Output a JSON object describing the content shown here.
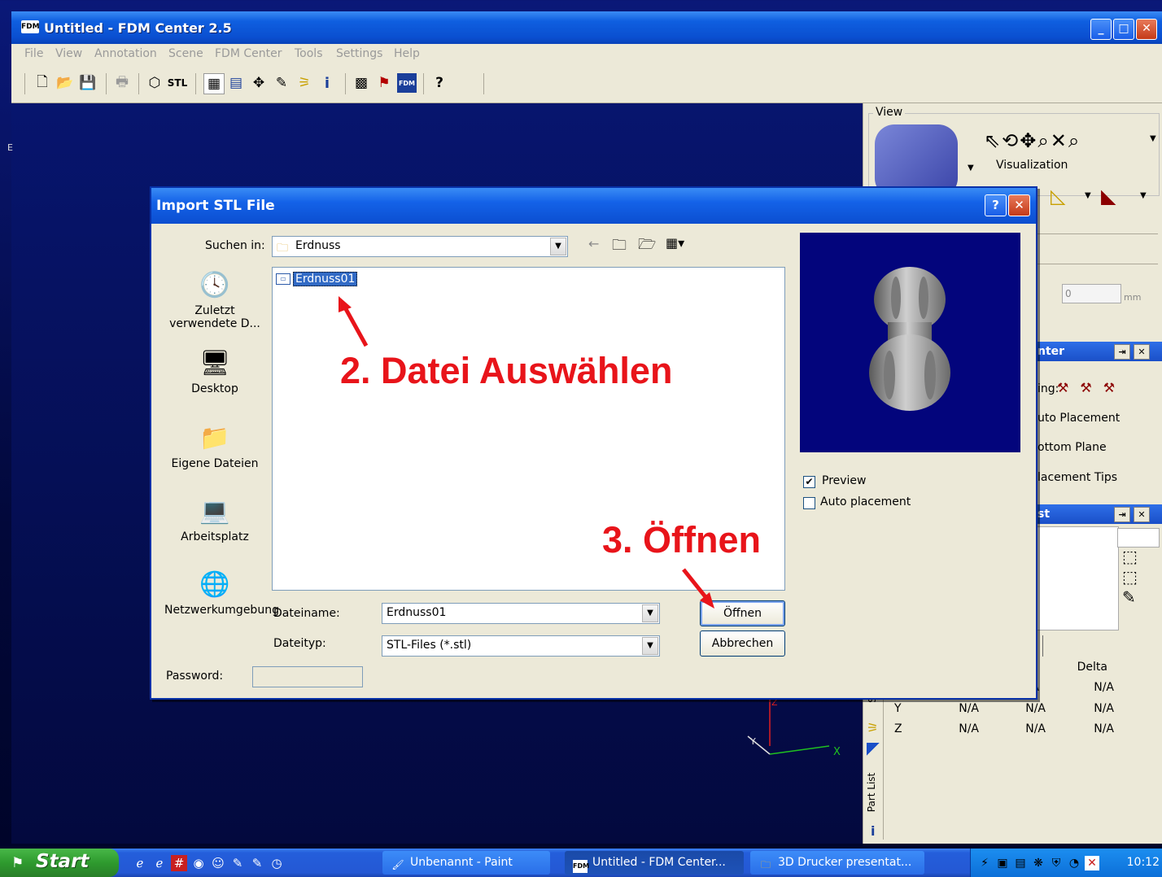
{
  "app": {
    "icon_text": "FDM",
    "title": "Untitled - FDM Center 2.5",
    "menu": [
      "File",
      "View",
      "Annotation",
      "Scene",
      "FDM Center",
      "Tools",
      "Settings",
      "Help"
    ],
    "toolbar_icons": [
      "new-icon",
      "open-icon",
      "save-icon",
      "print-icon",
      "import-icon",
      "stl-icon",
      "view-icon",
      "list-icon",
      "tool-icon",
      "measure-icon",
      "scene-icon",
      "info-icon",
      "grid-icon",
      "pack-icon",
      "fdm-icon",
      "help-icon"
    ],
    "toolbar_stl_text": "STL",
    "toolbar_fdm_text": "FDM",
    "toolbar_info_text": "i",
    "toolbar_help_text": "?"
  },
  "right_panel": {
    "view_label": "View",
    "visualization_label": "Visualization",
    "value_field": "0",
    "unit": "mm",
    "center_panel_title": "nter",
    "center_items": [
      "ing:",
      "uto Placement",
      "ottom Plane",
      "lacement Tips"
    ],
    "list_panel_title": "st",
    "delta_header": "Delta",
    "rows": [
      {
        "axis": "",
        "c1": "",
        "c2": "A",
        "c3": "N/A"
      },
      {
        "axis": "Y",
        "c1": "N/A",
        "c2": "N/A",
        "c3": "N/A"
      },
      {
        "axis": "Z",
        "c1": "N/A",
        "c2": "N/A",
        "c3": "N/A"
      }
    ],
    "vertical_tab": "Part List",
    "tab_s": "S",
    "tab_info": "i"
  },
  "viewport": {
    "axis_x": "X",
    "axis_y": "Y",
    "axis_z": "Z",
    "side_label": "E"
  },
  "dialog": {
    "title": "Import STL File",
    "help_btn": "?",
    "close_btn": "✕",
    "look_in_label": "Suchen in:",
    "look_in_value": "Erdnuss",
    "places": [
      {
        "label": "Zuletzt verwendete D...",
        "icon": "recent-icon"
      },
      {
        "label": "Desktop",
        "icon": "desktop-icon"
      },
      {
        "label": "Eigene Dateien",
        "icon": "my-documents-icon"
      },
      {
        "label": "Arbeitsplatz",
        "icon": "my-computer-icon"
      },
      {
        "label": "Netzwerkumgebung",
        "icon": "network-icon"
      }
    ],
    "files": [
      {
        "name": "Erdnuss01",
        "selected": true
      }
    ],
    "filename_label": "Dateiname:",
    "filename_value": "Erdnuss01",
    "filetype_label": "Dateityp:",
    "filetype_value": "STL-Files (*.stl)",
    "open_button": "Öffnen",
    "cancel_button": "Abbrechen",
    "preview_label": "Preview",
    "preview_checked": true,
    "auto_placement_label": "Auto placement",
    "auto_placement_checked": false,
    "password_label": "Password:"
  },
  "annotations": {
    "step2": "2. Datei Auswählen",
    "step3": "3. Öffnen",
    "color": "#e8141a"
  },
  "taskbar": {
    "start": "Start",
    "tasks": [
      {
        "label": "Unbenannt - Paint",
        "icon": "paint-icon",
        "active": false
      },
      {
        "label": "Untitled - FDM Center...",
        "icon": "fdm-icon",
        "active": true
      },
      {
        "label": "3D Drucker presentat...",
        "icon": "folder-icon",
        "active": false
      }
    ],
    "task_fdm_icon_text": "FDM",
    "clock": "10:12"
  }
}
